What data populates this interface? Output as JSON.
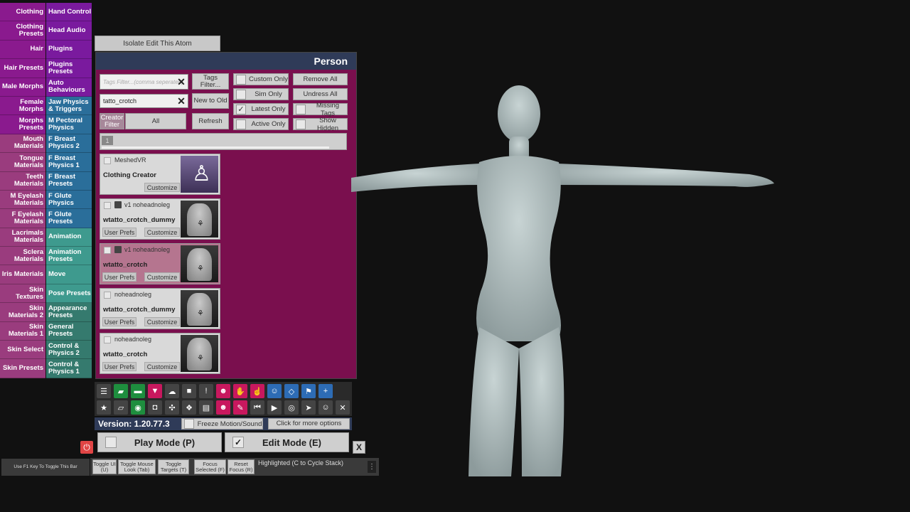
{
  "left_tabs": [
    {
      "label": "Clothing",
      "color": "#8a1a8e"
    },
    {
      "label": "Clothing Presets",
      "color": "#8a1a8e"
    },
    {
      "label": "Hair",
      "color": "#8a1a8e"
    },
    {
      "label": "Hair Presets",
      "color": "#8a1a8e"
    },
    {
      "label": "Male Morphs",
      "color": "#8a1a8e"
    },
    {
      "label": "Female Morphs",
      "color": "#8a1a8e"
    },
    {
      "label": "Morphs Presets",
      "color": "#8a1a8e"
    },
    {
      "label": "Mouth Materials",
      "color": "#9a3c7e"
    },
    {
      "label": "Tongue Materials",
      "color": "#9a3c7e"
    },
    {
      "label": "Teeth Materials",
      "color": "#9a3c7e"
    },
    {
      "label": "M Eyelash Materials",
      "color": "#9a3c7e"
    },
    {
      "label": "F Eyelash Materials",
      "color": "#9a3c7e"
    },
    {
      "label": "Lacrimals Materials",
      "color": "#9a3c7e"
    },
    {
      "label": "Sclera Materials",
      "color": "#9a3c7e"
    },
    {
      "label": "Iris Materials",
      "color": "#9a3c7e"
    },
    {
      "label": "Skin Textures",
      "color": "#9a3c7e"
    },
    {
      "label": "Skin Materials 2",
      "color": "#9a3c7e"
    },
    {
      "label": "Skin Materials 1",
      "color": "#9a3c7e"
    },
    {
      "label": "Skin Select",
      "color": "#9a3c7e"
    },
    {
      "label": "Skin Presets",
      "color": "#9a3c7e"
    }
  ],
  "right_tabs": [
    {
      "label": "Hand Control",
      "color": "#7a1a9e"
    },
    {
      "label": "Head Audio",
      "color": "#7a1a9e"
    },
    {
      "label": "Plugins",
      "color": "#7a1a9e"
    },
    {
      "label": "Plugins Presets",
      "color": "#7a1a9e"
    },
    {
      "label": "Auto Behaviours",
      "color": "#7a1a9e"
    },
    {
      "label": "Jaw Physics & Triggers",
      "color": "#2a6e9a"
    },
    {
      "label": "M Pectoral Physics",
      "color": "#2a6e9a"
    },
    {
      "label": "F Breast Physics 2",
      "color": "#2a6e9a"
    },
    {
      "label": "F Breast Physics 1",
      "color": "#2a6e9a"
    },
    {
      "label": "F Breast Presets",
      "color": "#2a6e9a"
    },
    {
      "label": "F Glute Physics",
      "color": "#2a6e9a"
    },
    {
      "label": "F Glute Presets",
      "color": "#2a6e9a"
    },
    {
      "label": "Animation",
      "color": "#3e9a8e"
    },
    {
      "label": "Animation Presets",
      "color": "#3e9a8e"
    },
    {
      "label": "Move",
      "color": "#3e9a8e"
    },
    {
      "label": "Pose Presets",
      "color": "#3e9a8e"
    },
    {
      "label": "Appearance Presets",
      "color": "#357a6e"
    },
    {
      "label": "General Presets",
      "color": "#357a6e"
    },
    {
      "label": "Control & Physics 2",
      "color": "#357a6e"
    },
    {
      "label": "Control & Physics 1",
      "color": "#357a6e"
    }
  ],
  "isolate_label": "Isolate Edit This Atom",
  "panel": {
    "title": "Person",
    "tags_filter_placeholder": "Tags Filter...(comma seperated)",
    "search_value": "tatto_crotch",
    "tags_filter_btn": "Tags Filter...",
    "new_to_old_btn": "New to Old",
    "creator_filter_label": "Creator Filter",
    "creator_filter_value": "All",
    "refresh_btn": "Refresh",
    "checks": {
      "custom_only": "Custom Only",
      "sim_only": "Sim Only",
      "latest_only": "Latest Only",
      "active_only": "Active Only"
    },
    "remove_all": "Remove All",
    "undress_all": "Undress All",
    "missing_tags": "Missing Tags",
    "show_hidden": "Show Hidden",
    "page_number": "1",
    "items": [
      {
        "meta": "MeshedVR",
        "name": "Clothing Creator",
        "user_prefs": "",
        "customize": "Customize"
      },
      {
        "meta": "v1  noheadnoleg",
        "name": "wtatto_crotch_dummy",
        "user_prefs": "User Prefs",
        "customize": "Customize"
      },
      {
        "meta": "v1  noheadnoleg",
        "name": "wtatto_crotch",
        "user_prefs": "User Prefs",
        "customize": "Customize"
      },
      {
        "meta": "noheadnoleg",
        "name": "wtatto_crotch_dummy",
        "user_prefs": "User Prefs",
        "customize": "Customize"
      },
      {
        "meta": "noheadnoleg",
        "name": "wtatto_crotch",
        "user_prefs": "User Prefs",
        "customize": "Customize"
      }
    ]
  },
  "toolbar_icons_row1": [
    {
      "name": "menu-icon",
      "glyph": "☰",
      "color": "#2a2a2a"
    },
    {
      "name": "open-scene-icon",
      "glyph": "▰",
      "color": "#1e8e3e"
    },
    {
      "name": "folder-icon",
      "glyph": "▬",
      "color": "#1e8e3e"
    },
    {
      "name": "save-icon",
      "glyph": "▼",
      "color": "#c8185e"
    },
    {
      "name": "cloud-icon",
      "glyph": "☁",
      "color": "#2a2a2a"
    },
    {
      "name": "package-icon",
      "glyph": "■",
      "color": "#2a2a2a"
    },
    {
      "name": "alert-icon",
      "glyph": "!",
      "color": "#2a2a2a"
    },
    {
      "name": "person-add-icon",
      "glyph": "☻",
      "color": "#c8185e"
    },
    {
      "name": "hand-icon",
      "glyph": "✋",
      "color": "#c8185e"
    },
    {
      "name": "pointer-hand-icon",
      "glyph": "☝",
      "color": "#c8185e"
    },
    {
      "name": "person-icon",
      "glyph": "☺",
      "color": "#2d6cb5"
    },
    {
      "name": "view-icon",
      "glyph": "◇",
      "color": "#2d6cb5"
    },
    {
      "name": "flag-icon",
      "glyph": "⚑",
      "color": "#2d6cb5"
    },
    {
      "name": "plus-icon",
      "glyph": "+",
      "color": "#2d6cb5"
    }
  ],
  "toolbar_icons_row2": [
    {
      "name": "star-icon",
      "glyph": "★",
      "color": "#2a2a2a"
    },
    {
      "name": "scene-save-icon",
      "glyph": "▱",
      "color": "#2a2a2a"
    },
    {
      "name": "screenshot-icon",
      "glyph": "◉",
      "color": "#1e8e3e"
    },
    {
      "name": "camera-icon",
      "glyph": "◘",
      "color": "#2a2a2a"
    },
    {
      "name": "graph-icon",
      "glyph": "✣",
      "color": "#2a2a2a"
    },
    {
      "name": "dropbox-icon",
      "glyph": "❖",
      "color": "#2a2a2a"
    },
    {
      "name": "document-icon",
      "glyph": "▤",
      "color": "#2a2a2a"
    },
    {
      "name": "person-remove-icon",
      "glyph": "☻",
      "color": "#c8185e"
    },
    {
      "name": "wrench-icon",
      "glyph": "✎",
      "color": "#c8185e"
    },
    {
      "name": "rewind-icon",
      "glyph": "⏮",
      "color": "#2a2a2a"
    },
    {
      "name": "play-icon",
      "glyph": "▶",
      "color": "#2a2a2a"
    },
    {
      "name": "target-icon",
      "glyph": "◎",
      "color": "#2a2a2a"
    },
    {
      "name": "cursor-icon",
      "glyph": "➤",
      "color": "#2a2a2a"
    },
    {
      "name": "people-icon",
      "glyph": "☺",
      "color": "#2a2a2a"
    },
    {
      "name": "tools-icon",
      "glyph": "✕",
      "color": "#2a2a2a"
    }
  ],
  "version": "Version: 1.20.77.3",
  "freeze_label": "Freeze Motion/Sound",
  "more_options": "Click for more options",
  "play_mode": "Play Mode (P)",
  "edit_mode": "Edit Mode (E)",
  "close_label": "X",
  "f1_hint": "Use F1 Key To Toggle This Bar",
  "bottom_buttons": [
    "Toggle UI (U)",
    "Toggle Mouse Look (Tab)",
    "Toggle Targets (T)",
    "Focus Selected (F)",
    "Reset Focus (R)"
  ],
  "highlighted_text": "Highlighted (C to Cycle Stack)",
  "colors": {
    "panel_bg": "#7a0f4e",
    "header_bg": "#2f3b58"
  }
}
